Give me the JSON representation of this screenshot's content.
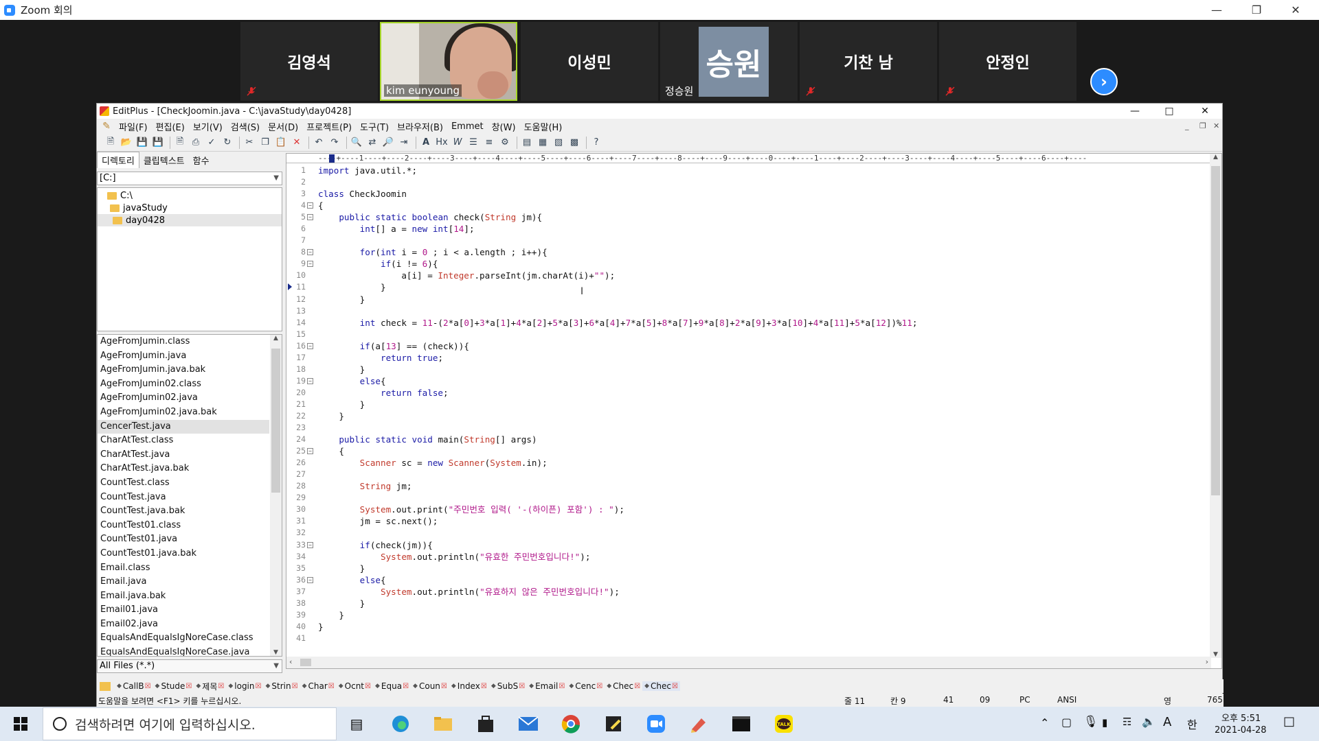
{
  "zoom": {
    "title": "Zoom 회의",
    "participants": [
      {
        "name": "김영석",
        "muted": true
      },
      {
        "name": "kim eunyoung",
        "video": true,
        "muted": true
      },
      {
        "name": "이성민",
        "muted": true
      },
      {
        "initials": "승원",
        "name": "정승원"
      },
      {
        "name": "기찬 남",
        "muted": true
      },
      {
        "name": "안정인",
        "muted": true
      }
    ]
  },
  "editplus": {
    "title": "EditPlus - [CheckJoomin.java - C:\\javaStudy\\day0428]",
    "menu": [
      "파일(F)",
      "편집(E)",
      "보기(V)",
      "검색(S)",
      "문서(D)",
      "프로젝트(P)",
      "도구(T)",
      "브라우저(B)",
      "Emmet",
      "창(W)",
      "도움말(H)"
    ],
    "panel_tabs": [
      "디렉토리",
      "클립텍스트",
      "함수"
    ],
    "drive": "[C:]",
    "dirs": [
      "C:\\",
      "javaStudy",
      "day0428"
    ],
    "files": [
      "AgeFromJumin.class",
      "AgeFromJumin.java",
      "AgeFromJumin.java.bak",
      "AgeFromJumin02.class",
      "AgeFromJumin02.java",
      "AgeFromJumin02.java.bak",
      "CencerTest.java",
      "CharAtTest.class",
      "CharAtTest.java",
      "CharAtTest.java.bak",
      "CountTest.class",
      "CountTest.java",
      "CountTest.java.bak",
      "CountTest01.class",
      "CountTest01.java",
      "CountTest01.java.bak",
      "Email.class",
      "Email.java",
      "Email.java.bak",
      "Email01.java",
      "Email02.java",
      "EqualsAndEqualsIgNoreCase.class",
      "EqualsAndEqualsIgNoreCase.java"
    ],
    "filter": "All Files (*.*)",
    "ruler": "----+----1----+----2----+----3----+----4----+----5----+----6----+----7----+----8----+----9----+----0----+----1----+----2----+----3----+----4----+----5----+----6----+----",
    "code": [
      "import java.util.*;",
      "",
      "class CheckJoomin",
      "{",
      "    public static boolean check(String jm){",
      "        int[] a = new int[14];",
      "",
      "        for(int i = 0 ; i < a.length ; i++){",
      "            if(i != 6){",
      "                a[i] = Integer.parseInt(jm.charAt(i)+\"\");",
      "            }",
      "        }",
      "",
      "        int check = 11-(2*a[0]+3*a[1]+4*a[2]+5*a[3]+6*a[4]+7*a[5]+8*a[7]+9*a[8]+2*a[9]+3*a[10]+4*a[11]+5*a[12])%11;",
      "",
      "        if(a[13] == (check)){",
      "            return true;",
      "        }",
      "        else{",
      "            return false;",
      "        }",
      "    }",
      "",
      "    public static void main(String[] args)",
      "    {",
      "        Scanner sc = new Scanner(System.in);",
      "",
      "        String jm;",
      "",
      "        System.out.print(\"주민번호 입력( '-(하이픈) 포함') : \");",
      "        jm = sc.next();",
      "",
      "        if(check(jm)){",
      "            System.out.println(\"유효한 주민번호입니다!\");",
      "        }",
      "        else{",
      "            System.out.println(\"유효하지 않은 주민번호입니다!\");",
      "        }",
      "    }",
      "}",
      ""
    ],
    "folds": [
      4,
      5,
      8,
      9,
      16,
      19,
      25,
      33,
      36
    ],
    "current_line": 11,
    "doc_tabs": [
      "CallB",
      "Stude",
      "제목",
      "login",
      "Strin",
      "Char",
      "Ocnt",
      "Equa",
      "Coun",
      "Index",
      "SubS",
      "Email",
      "Cenc",
      "Chec",
      "Chec"
    ],
    "status": {
      "help": "도움말을 보려면 <F1> 키를 누르십시오.",
      "line": "줄 11",
      "col": "칸 9",
      "total": "41",
      "colnum": "09",
      "mode": "PC",
      "encoding": "ANSI",
      "ovr": "영",
      "size": "765"
    }
  },
  "taskbar": {
    "search_placeholder": "검색하려면 여기에 입력하십시오.",
    "time": "오후 5:51",
    "date": "2021-04-28",
    "ime": "A",
    "lang": "한"
  }
}
